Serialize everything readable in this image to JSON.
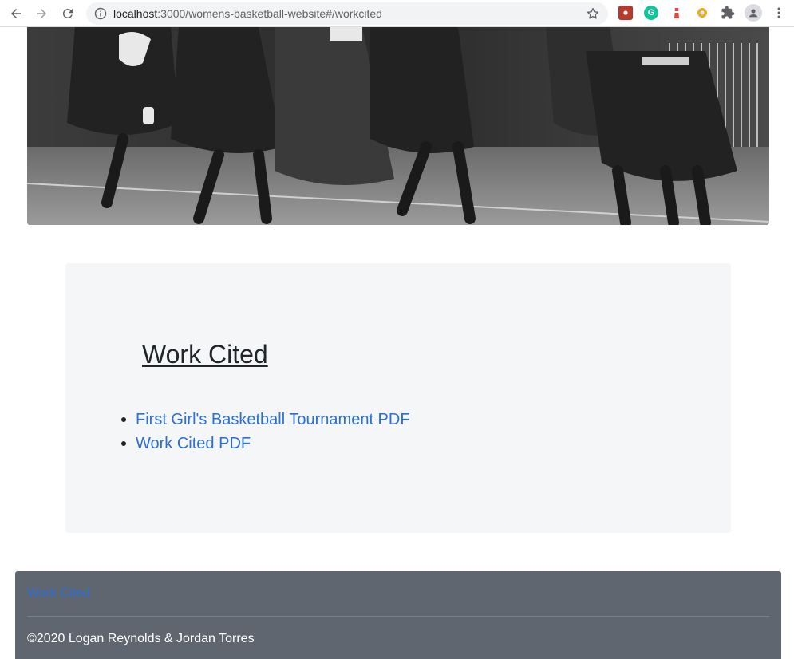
{
  "browser": {
    "url_host": "localhost",
    "url_rest": ":3000/womens-basketball-website#/workcited",
    "icons": [
      "back-icon",
      "forward-icon",
      "reload-icon",
      "info-icon",
      "star-icon",
      "puzzle-icon",
      "profile-icon",
      "menu-icon"
    ],
    "extensions": [
      {
        "name": "extension-red-icon",
        "color": "#c0392b",
        "glyph": "▣"
      },
      {
        "name": "grammarly-icon",
        "color": "#15c39a",
        "glyph": "G"
      },
      {
        "name": "extension-lighthouse-icon",
        "color": "#e8453c",
        "glyph": "▲"
      },
      {
        "name": "extension-gear-icon",
        "color": "#f4a62a",
        "glyph": "✹"
      }
    ]
  },
  "hero": {
    "alt": "historical women's basketball photo"
  },
  "work_cited": {
    "title": "Work Cited",
    "links": [
      {
        "label": "First Girl's Basketball Tournament PDF"
      },
      {
        "label": "Work Cited PDF"
      }
    ],
    "link_color": "#2b6fd6"
  },
  "footer": {
    "nav_link": "Work Cited",
    "copyright": "©2020 Logan Reynolds & Jordan Torres",
    "background": "#5f6670"
  }
}
